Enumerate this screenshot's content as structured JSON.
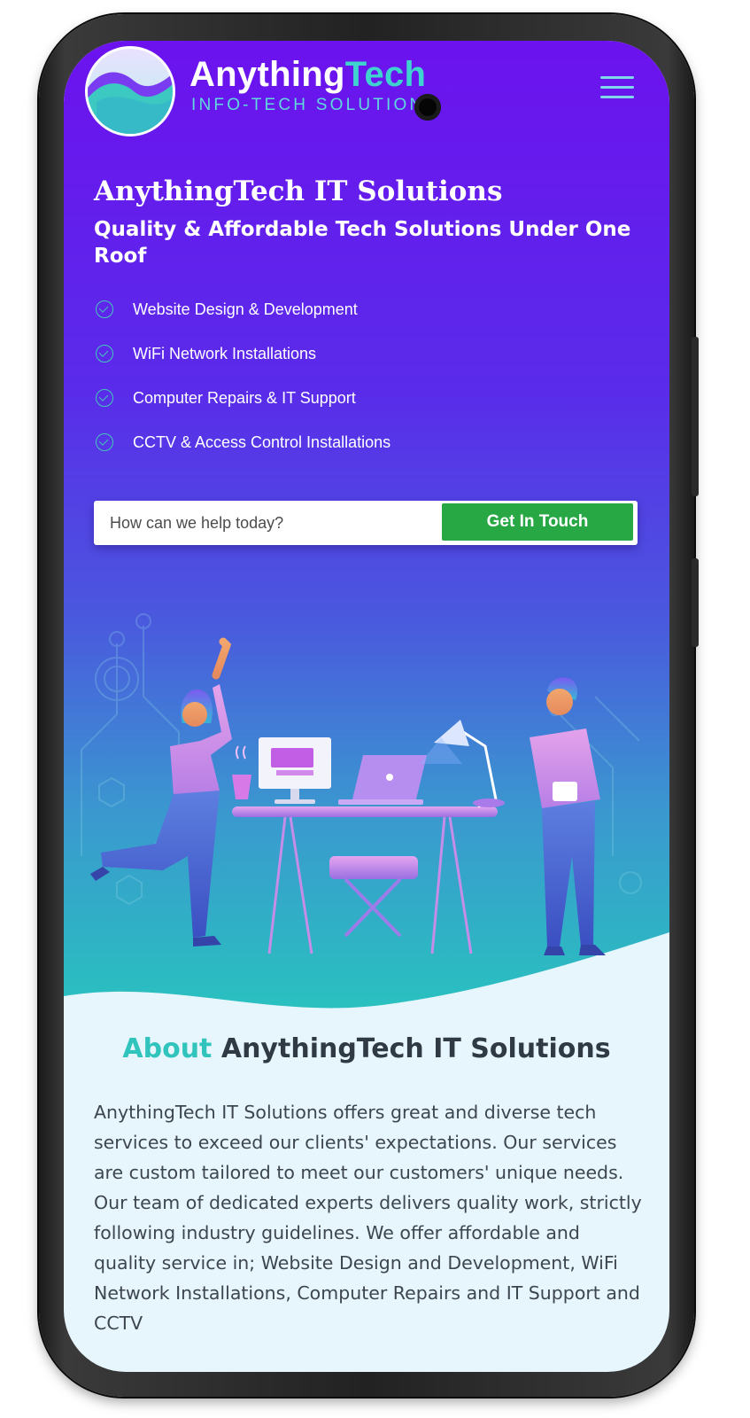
{
  "header": {
    "brand_name_part1": "Anything",
    "brand_name_part2": "Tech",
    "brand_tagline": "INFO-TECH SOLUTIONS",
    "menu_icon": "hamburger-menu-icon"
  },
  "hero": {
    "title": "AnythingTech IT Solutions",
    "subtitle": "Quality & Affordable Tech Solutions Under One Roof",
    "services": [
      {
        "label": "Website Design & Development",
        "icon": "check-circle-icon"
      },
      {
        "label": "WiFi Network Installations",
        "icon": "check-circle-icon"
      },
      {
        "label": "Computer Repairs & IT Support",
        "icon": "check-circle-icon"
      },
      {
        "label": "CCTV & Access Control Installations",
        "icon": "check-circle-icon"
      }
    ],
    "contact": {
      "placeholder": "How can we help today?",
      "button_label": "Get In Touch"
    }
  },
  "about": {
    "title_accent": "About",
    "title_rest": "AnythingTech IT Solutions",
    "text": "AnythingTech IT Solutions offers great and diverse tech services to exceed our clients' expectations. Our services are custom tailored to meet our customers' unique needs. Our team of dedicated experts delivers quality work, strictly following industry guidelines. We offer affordable and quality service in; Website Design and Development, WiFi Network Installations, Computer Repairs and IT Support and CCTV"
  },
  "colors": {
    "hero_top": "#6c12ee",
    "hero_bottom": "#27c6bd",
    "accent_teal": "#31c4bd",
    "button_green": "#28a745",
    "about_bg": "#e7f5fd",
    "heading_dark": "#303a44"
  }
}
